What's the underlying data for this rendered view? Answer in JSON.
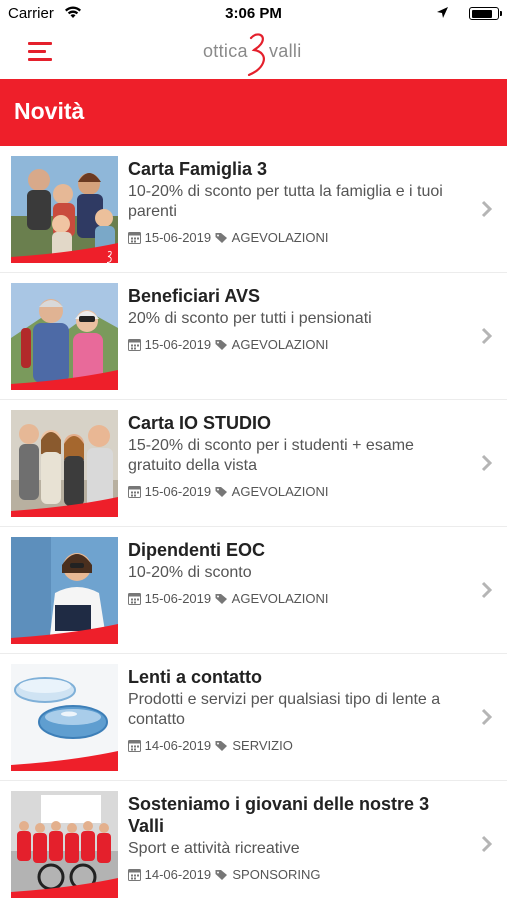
{
  "status_bar": {
    "carrier": "Carrier",
    "time": "3:06 PM",
    "battery_level": 0.85
  },
  "nav": {
    "menu_icon": "hamburger-icon",
    "logo_left": "ottica",
    "logo_right": "valli"
  },
  "header": {
    "title": "Novità"
  },
  "colors": {
    "brand_red": "#ee1f2a",
    "chevron": "#b5b5b5"
  },
  "items": [
    {
      "title": "Carta Famiglia 3",
      "description": "10-20% di sconto per tutta la famiglia e i tuoi parenti",
      "date": "15-06-2019",
      "tag": "AGEVOLAZIONI",
      "image": "family-photo"
    },
    {
      "title": "Beneficiari AVS",
      "description": "20% di sconto per tutti i pensionati",
      "date": "15-06-2019",
      "tag": "AGEVOLAZIONI",
      "image": "seniors-photo"
    },
    {
      "title": "Carta IO STUDIO",
      "description": "15-20% di sconto per i studenti + esame gratuito della vista",
      "date": "15-06-2019",
      "tag": "AGEVOLAZIONI",
      "image": "students-photo"
    },
    {
      "title": "Dipendenti EOC",
      "description": "10-20% di sconto",
      "date": "15-06-2019",
      "tag": "AGEVOLAZIONI",
      "image": "nurse-photo"
    },
    {
      "title": "Lenti a contatto",
      "description": "Prodotti e servizi per qualsiasi tipo di lente a contatto",
      "date": "14-06-2019",
      "tag": "SERVIZIO",
      "image": "contact-lens-photo"
    },
    {
      "title": "Sosteniamo i giovani delle nostre 3 Valli",
      "description": "Sport e attività ricreative",
      "date": "14-06-2019",
      "tag": "SPONSORING",
      "image": "cycling-team-photo"
    }
  ]
}
